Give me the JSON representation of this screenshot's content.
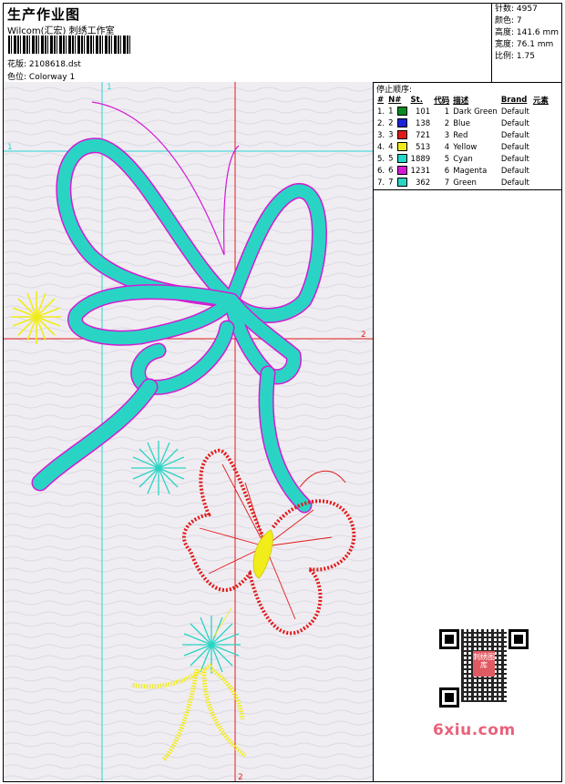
{
  "header": {
    "title": "生产作业图",
    "company": "Wilcom(汇宏) 刺绣工作室",
    "file_label": "花版:",
    "file_value": "2108618.dst",
    "colorway_label": "色位:",
    "colorway_value": "Colorway 1"
  },
  "stats": {
    "stitches": "针数: 4957",
    "colors": "颜色: 7",
    "height": "高度: 141.6 mm",
    "width": "宽度: 76.1 mm",
    "scale": "比例: 1.75"
  },
  "sequence": {
    "title": "停止顺序:",
    "headers": [
      "#",
      "N#",
      "St.",
      "代码",
      "描述",
      "Brand",
      "元素"
    ],
    "rows": [
      {
        "idx": "1.",
        "n": "1",
        "color": "#0a8a23",
        "st": "101",
        "code": "1",
        "desc": "Dark Green",
        "brand": "Default"
      },
      {
        "idx": "2.",
        "n": "2",
        "color": "#1a23d6",
        "st": "138",
        "code": "2",
        "desc": "Blue",
        "brand": "Default"
      },
      {
        "idx": "3.",
        "n": "3",
        "color": "#e01a1a",
        "st": "721",
        "code": "3",
        "desc": "Red",
        "brand": "Default"
      },
      {
        "idx": "4.",
        "n": "4",
        "color": "#f2ec1a",
        "st": "513",
        "code": "4",
        "desc": "Yellow",
        "brand": "Default"
      },
      {
        "idx": "5.",
        "n": "5",
        "color": "#22d8c8",
        "st": "1889",
        "code": "5",
        "desc": "Cyan",
        "brand": "Default"
      },
      {
        "idx": "6.",
        "n": "6",
        "color": "#d41ad4",
        "st": "1231",
        "code": "6",
        "desc": "Magenta",
        "brand": "Default"
      },
      {
        "idx": "7.",
        "n": "7",
        "color": "#2ad4c4",
        "st": "362",
        "code": "7",
        "desc": "Green",
        "brand": "Default"
      }
    ]
  },
  "guides": {
    "v1": "1",
    "h1": "1",
    "h2": "2",
    "v2": "2"
  },
  "qr": {
    "seal_text": "刺绣图库"
  },
  "watermark": "6xiu.com"
}
